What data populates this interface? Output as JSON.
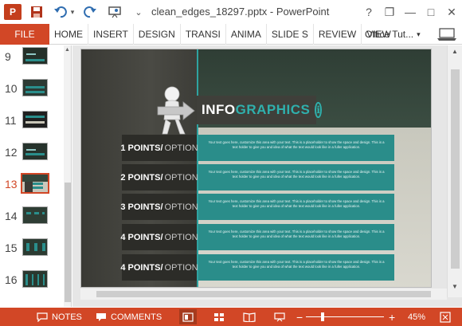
{
  "window": {
    "title": "clean_edges_18297.pptx - PowerPoint",
    "app_badge": "P",
    "controls": {
      "help": "?",
      "restore": "❐",
      "minimize": "—",
      "maximize": "□",
      "close": "✕"
    }
  },
  "quick_access": {
    "icons": [
      "save-icon",
      "undo-icon",
      "redo-icon",
      "slideshow-icon",
      "customize-icon"
    ],
    "customize_glyph": "⌄"
  },
  "ribbon": {
    "file_label": "FILE",
    "tabs": [
      "HOME",
      "INSERT",
      "DESIGN",
      "TRANSI",
      "ANIMA",
      "SLIDE S",
      "REVIEW",
      "VIEW"
    ],
    "account": "Office Tut...",
    "account_caret": "▾"
  },
  "thumbnails": {
    "items": [
      {
        "number": "9",
        "active": false
      },
      {
        "number": "10",
        "active": false
      },
      {
        "number": "11",
        "active": false
      },
      {
        "number": "12",
        "active": false
      },
      {
        "number": "13",
        "active": true
      },
      {
        "number": "14",
        "active": false
      },
      {
        "number": "15",
        "active": false
      },
      {
        "number": "16",
        "active": false
      }
    ],
    "scroll_up": "▲"
  },
  "slide": {
    "title_part1": "INFO",
    "title_part2": "GRAPHICS",
    "title_icon": "i",
    "rows": [
      {
        "num": "1 POINTS/",
        "opt": "OPTION",
        "text": "Your text goes here, customize this area with your text. This is a placeholder to show the space and design. This is a text holder to give you and idea of what the text would look like in a fuller application."
      },
      {
        "num": "2 POINTS/",
        "opt": "OPTION",
        "text": "Your text goes here, customize this area with your text. This is a placeholder to show the space and design. This is a text holder to give you and idea of what the text would look like in a fuller application."
      },
      {
        "num": "3 POINTS/",
        "opt": "OPTION",
        "text": "Your text goes here, customize this area with your text. This is a placeholder to show the space and design. This is a text holder to give you and idea of what the text would look like in a fuller application."
      },
      {
        "num": "4 POINTS/",
        "opt": "OPTION",
        "text": "Your text goes here, customize this area with your text. This is a placeholder to show the space and design. This is a text holder to give you and idea of what the text would look like in a fuller application."
      },
      {
        "num": "4 POINTS/",
        "opt": "OPTION",
        "text": "Your text goes here, customize this area with your text. This is a placeholder to show the space and design. This is a text holder to give you and idea of what the text would look like in a fuller application."
      }
    ]
  },
  "scrollbars": {
    "up": "▲",
    "down": "▼"
  },
  "statusbar": {
    "notes": "NOTES",
    "comments": "COMMENTS",
    "zoom_minus": "−",
    "zoom_plus": "+",
    "zoom_percent": "45%"
  },
  "colors": {
    "accent": "#d24726",
    "teal": "#2a8d8a",
    "slide_dark": "#2f3e35"
  }
}
